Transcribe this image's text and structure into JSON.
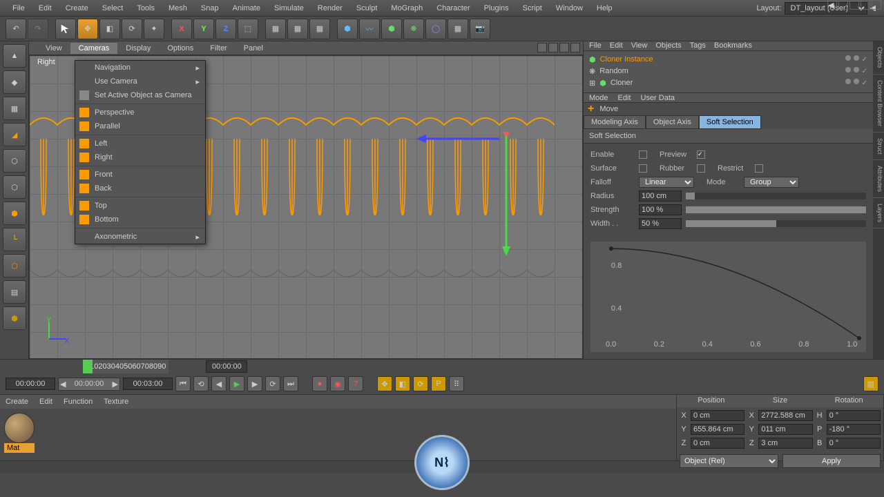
{
  "menubar": [
    "File",
    "Edit",
    "Create",
    "Select",
    "Tools",
    "Mesh",
    "Snap",
    "Animate",
    "Simulate",
    "Render",
    "Sculpt",
    "MoGraph",
    "Character",
    "Plugins",
    "Script",
    "Window",
    "Help"
  ],
  "layout": {
    "label": "Layout:",
    "value": "DT_layout (User)"
  },
  "obj_menubar": [
    "File",
    "Edit",
    "View",
    "Objects",
    "Tags",
    "Bookmarks"
  ],
  "objects": [
    {
      "name": "Cloner Instance",
      "color": "#f90",
      "selected": true
    },
    {
      "name": "Random",
      "color": "#ccc"
    },
    {
      "name": "Cloner",
      "color": "#ccc"
    }
  ],
  "view_menu": [
    "View",
    "Cameras",
    "Display",
    "Options",
    "Filter",
    "Panel"
  ],
  "view_active": "Cameras",
  "view_label": "Right",
  "camera_menu": {
    "nav": "Navigation",
    "use": "Use Camera",
    "setactive": "Set Active Object as Camera",
    "persp": "Perspective",
    "para": "Parallel",
    "left": "Left",
    "right": "Right",
    "front": "Front",
    "back": "Back",
    "top": "Top",
    "bottom": "Bottom",
    "axon": "Axonometric"
  },
  "attr_menu": [
    "Mode",
    "Edit",
    "User Data"
  ],
  "attr_tool": {
    "icon": "+",
    "label": "Move"
  },
  "tabs": [
    "Modeling Axis",
    "Object Axis",
    "Soft Selection"
  ],
  "tab_active": "Soft Selection",
  "section": "Soft Selection",
  "props": {
    "enable": {
      "label": "Enable",
      "val": false
    },
    "preview": {
      "label": "Preview",
      "val": true
    },
    "surface": {
      "label": "Surface",
      "val": false
    },
    "rubber": {
      "label": "Rubber",
      "val": false
    },
    "restrict": {
      "label": "Restrict",
      "val": false
    },
    "falloff": {
      "label": "Falloff",
      "val": "Linear"
    },
    "mode": {
      "label": "Mode",
      "val": "Group"
    },
    "radius": {
      "label": "Radius",
      "val": "100 cm",
      "pct": 5
    },
    "strength": {
      "label": "Strength",
      "val": "100 %",
      "pct": 100
    },
    "width": {
      "label": "Width . .",
      "val": "50 %",
      "pct": 50
    }
  },
  "curve_ticks": {
    "y": [
      "0.8",
      "0.4"
    ],
    "x": [
      "0.0",
      "0.2",
      "0.4",
      "0.6",
      "0.8",
      "1.0"
    ]
  },
  "timeline": {
    "marks": [
      "0",
      "10",
      "20",
      "30",
      "40",
      "50",
      "60",
      "70",
      "80",
      "90"
    ],
    "timecode": "00:00:00"
  },
  "playback": {
    "cur": "00:00:00",
    "start": "00:00:00",
    "end": "00:03:00"
  },
  "mat_menu": [
    "Create",
    "Edit",
    "Function",
    "Texture"
  ],
  "material": {
    "name": "Mat"
  },
  "coords": {
    "headers": [
      "Position",
      "Size",
      "Rotation"
    ],
    "rows": [
      {
        "a": "X",
        "p": "0 cm",
        "sa": "X",
        "s": "2772.588 cm",
        "ra": "H",
        "r": "0 °"
      },
      {
        "a": "Y",
        "p": "655.864 cm",
        "sa": "Y",
        "s": "011 cm",
        "ra": "P",
        "r": "-180 °"
      },
      {
        "a": "Z",
        "p": "0 cm",
        "sa": "Z",
        "s": "3 cm",
        "ra": "B",
        "r": "0 °"
      }
    ],
    "mode": "Object (Rel)",
    "apply": "Apply"
  },
  "right_tabs": [
    "Objects",
    "Content Browser",
    "Struct",
    "Attributes",
    "Layers"
  ]
}
